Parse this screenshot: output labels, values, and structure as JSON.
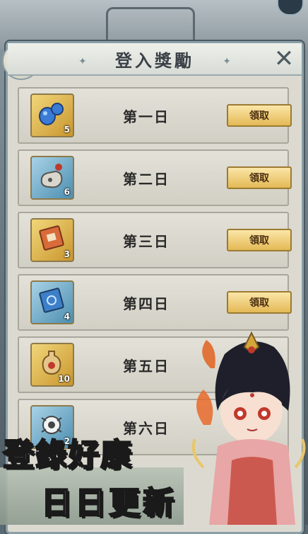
{
  "dialog": {
    "title": "登入獎勵",
    "close_icon": "close-x-icon"
  },
  "rewards": [
    {
      "day": "第一日",
      "count": "5",
      "icon": "blue-gourd-icon",
      "frame": "gold",
      "claim": "領取"
    },
    {
      "day": "第二日",
      "count": "6",
      "icon": "pouch-icon",
      "frame": "blue",
      "claim": "領取"
    },
    {
      "day": "第三日",
      "count": "3",
      "icon": "red-book-icon",
      "frame": "gold",
      "claim": "領取"
    },
    {
      "day": "第四日",
      "count": "4",
      "icon": "blue-book-icon",
      "frame": "blue",
      "claim": "領取"
    },
    {
      "day": "第五日",
      "count": "10",
      "icon": "wine-jar-icon",
      "frame": "gold",
      "claim": ""
    },
    {
      "day": "第六日",
      "count": "2",
      "icon": "spirit-orb-icon",
      "frame": "blue",
      "claim": ""
    }
  ],
  "slogan": {
    "line1": "登錄好康",
    "line2": "日日更新"
  }
}
